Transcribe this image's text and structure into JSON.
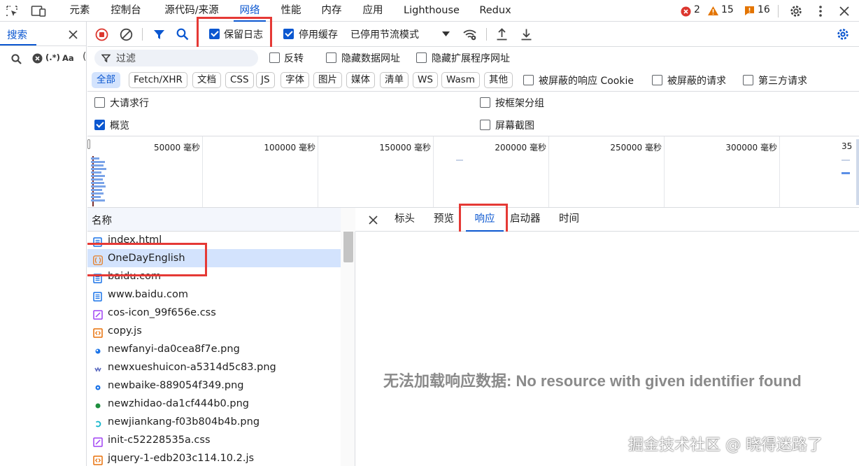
{
  "main_tabs": [
    "元素",
    "控制台",
    "源代码/来源",
    "网络",
    "性能",
    "内存",
    "应用",
    "Lighthouse",
    "Redux"
  ],
  "status": {
    "errors": "2",
    "warnings": "15",
    "issues": "16"
  },
  "search_panel": {
    "tab_label": "搜索",
    "regex_label": "(.*)",
    "case_label": "Aa"
  },
  "toolbar": {
    "preserve_log": {
      "label": "保留日志",
      "checked": true
    },
    "disable_cache": {
      "label": "停用缓存",
      "checked": true
    },
    "throttling": "已停用节流模式"
  },
  "filter": {
    "placeholder": "过滤",
    "invert": "反转",
    "hide_data_urls": "隐藏数据网址",
    "hide_extension_urls": "隐藏扩展程序网址"
  },
  "type_chips": [
    "全部",
    "Fetch/XHR",
    "文档",
    "CSS",
    "JS",
    "字体",
    "图片",
    "媒体",
    "清单",
    "WS",
    "Wasm",
    "其他"
  ],
  "chip_checkboxes": [
    "被屏蔽的响应 Cookie",
    "被屏蔽的请求",
    "第三方请求"
  ],
  "options": {
    "big_rows": {
      "label": "大请求行",
      "checked": false
    },
    "group_by_frame": {
      "label": "按框架分组",
      "checked": false
    },
    "overview": {
      "label": "概览",
      "checked": true
    },
    "screenshots": {
      "label": "屏幕截图",
      "checked": false
    }
  },
  "overview_ticks": [
    "50000 毫秒",
    "100000 毫秒",
    "150000 毫秒",
    "200000 毫秒",
    "250000 毫秒",
    "300000 毫秒",
    "35"
  ],
  "request_list": {
    "header": "名称",
    "rows": [
      {
        "name": "index.html",
        "type": "doc",
        "color": "#1a73e8"
      },
      {
        "name": "OneDayEnglish",
        "type": "fetch",
        "color": "#e8710a"
      },
      {
        "name": "baidu.com",
        "type": "doc",
        "color": "#1a73e8"
      },
      {
        "name": "www.baidu.com",
        "type": "doc",
        "color": "#1a73e8"
      },
      {
        "name": "cos-icon_99f656e.css",
        "type": "css",
        "color": "#a142f4"
      },
      {
        "name": "copy.js",
        "type": "js",
        "color": "#e8710a"
      },
      {
        "name": "newfanyi-da0cea8f7e.png",
        "type": "img",
        "color": "#1a73e8"
      },
      {
        "name": "newxueshuicon-a5314d5c83.png",
        "type": "img",
        "color": "#5c6bc0"
      },
      {
        "name": "newbaike-889054f349.png",
        "type": "img",
        "color": "#1a73e8"
      },
      {
        "name": "newzhidao-da1cf444b0.png",
        "type": "img",
        "color": "#1e8e3e"
      },
      {
        "name": "newjiankang-f03b804b4b.png",
        "type": "img",
        "color": "#12b5cb"
      },
      {
        "name": "init-c52228535a.css",
        "type": "css",
        "color": "#a142f4"
      },
      {
        "name": "jquery-1-edb203c114.10.2.js",
        "type": "js",
        "color": "#e8710a"
      }
    ]
  },
  "detail_tabs": [
    "标头",
    "预览",
    "响应",
    "启动器",
    "时间"
  ],
  "detail_message": "无法加载响应数据: No resource with given identifier found",
  "watermark": "掘金技术社区 @ 晓得迷路了",
  "colors": {
    "accent": "#0b57d0",
    "highlight_box": "#e53935",
    "selected_row": "#d3e3fd"
  }
}
